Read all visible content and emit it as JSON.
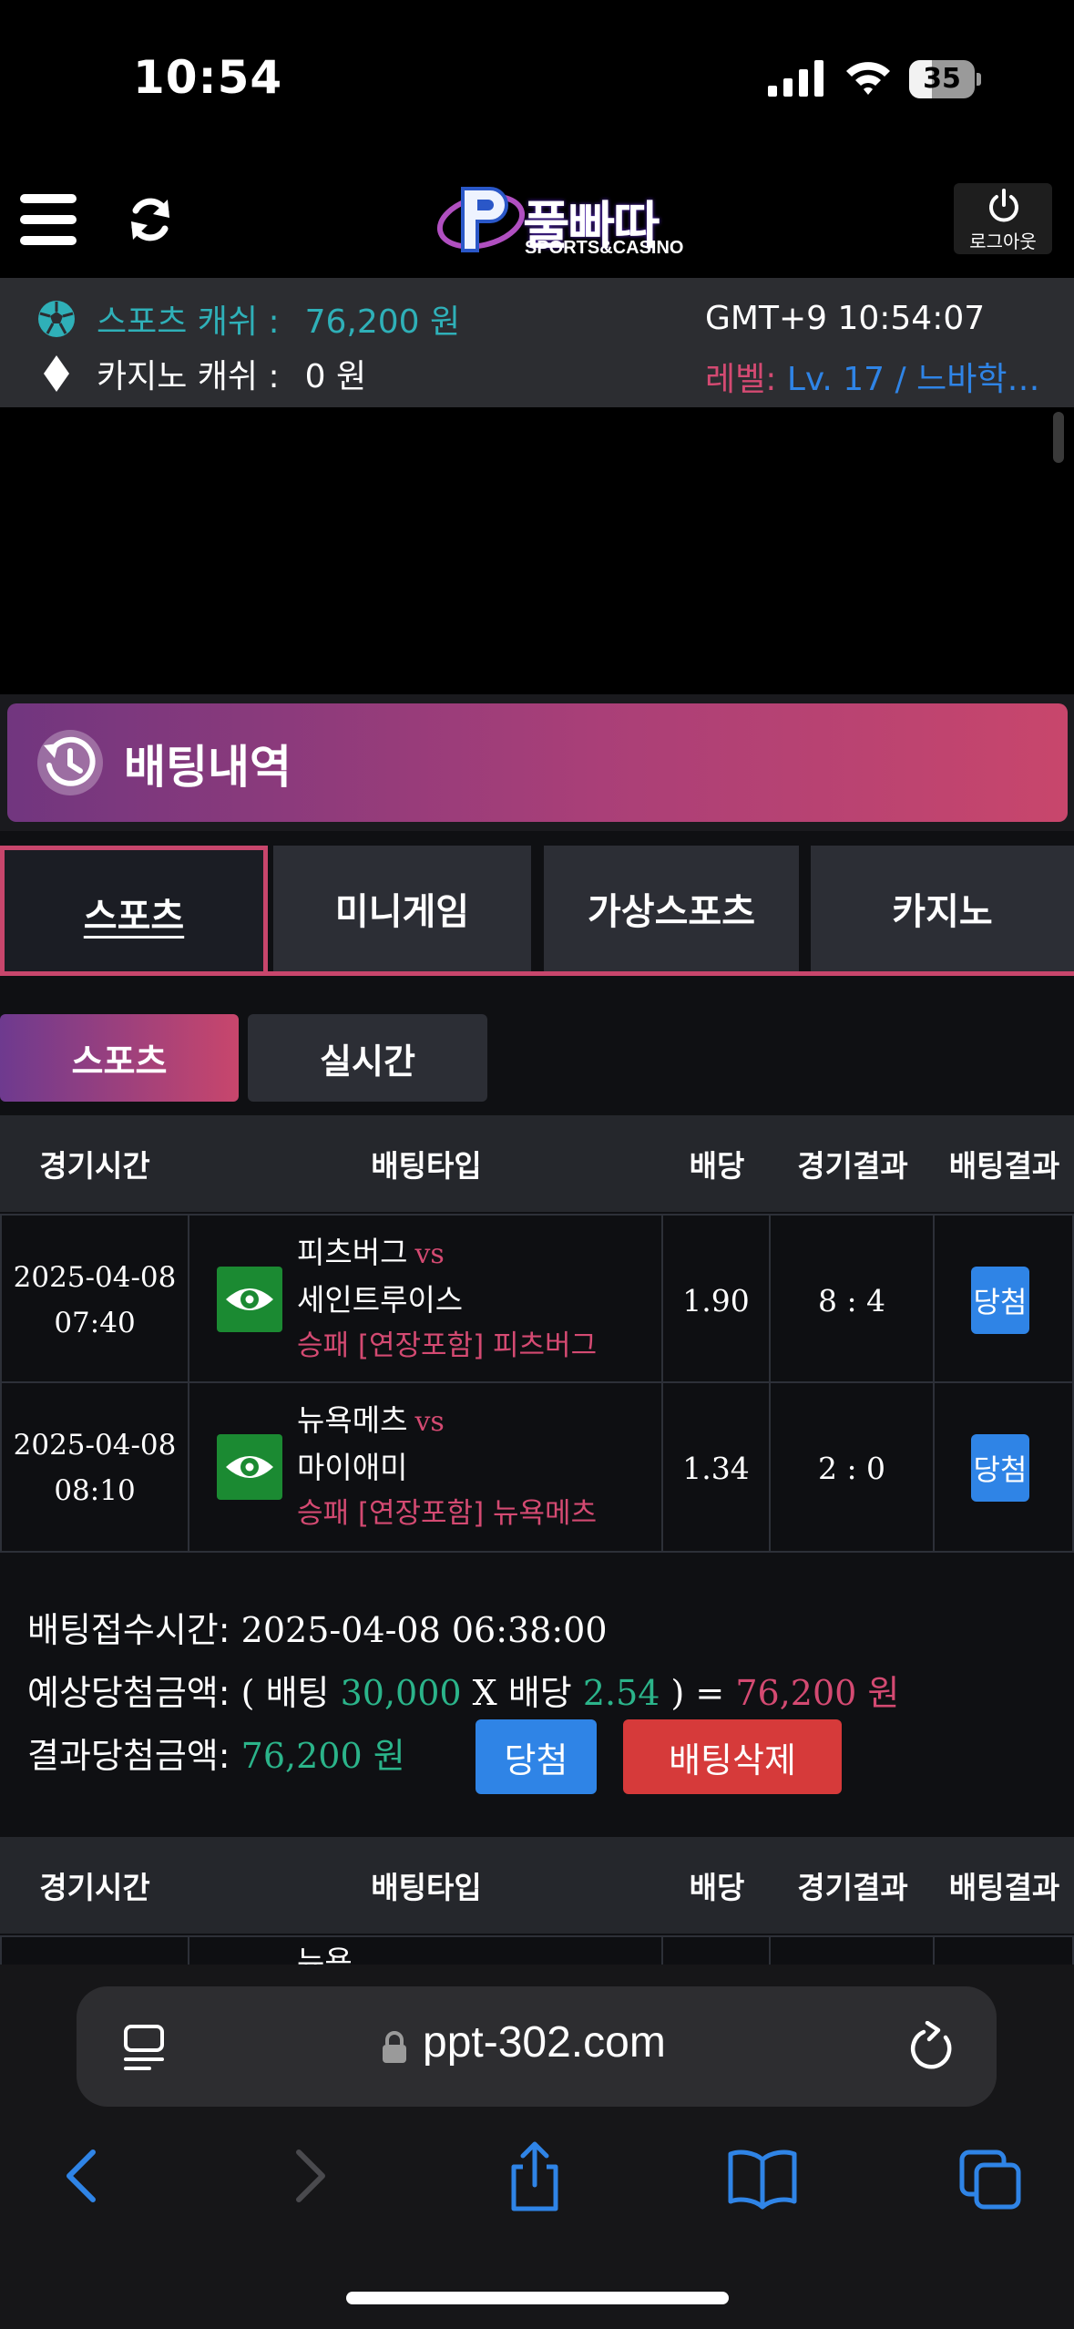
{
  "status_bar": {
    "time": "10:54",
    "battery": "35",
    "battery_level": 0.35
  },
  "header": {
    "logo_text": "풀빠따",
    "logo_sub": "SPORTS&CASINO",
    "logout_label": "로그아웃"
  },
  "account": {
    "sports_cash_label": "스포츠 캐쉬 :",
    "sports_cash_value": "76,200 원",
    "casino_cash_label": "카지노 캐쉬 :",
    "casino_cash_value": "0 원",
    "clock": "GMT+9 10:54:07",
    "level_prefix": "레벨:",
    "level_value": "Lv. 17 / 느바학…"
  },
  "page_title": "배팅내역",
  "main_tabs": [
    {
      "label": "스포츠",
      "active": true
    },
    {
      "label": "미니게임",
      "active": false
    },
    {
      "label": "가상스포츠",
      "active": false
    },
    {
      "label": "카지노",
      "active": false
    }
  ],
  "sub_tabs": [
    {
      "label": "스포츠",
      "active": true
    },
    {
      "label": "실시간",
      "active": false
    }
  ],
  "table_headers": [
    "경기시간",
    "배팅타입",
    "배당",
    "경기결과",
    "배팅결과"
  ],
  "bets": [
    {
      "date": "2025-04-08",
      "time": "07:40",
      "home": "피츠버그",
      "vs": "vs",
      "away": "세인트루이스",
      "pick": "승패 [연장포함] 피츠버그",
      "odds": "1.90",
      "score": "8 : 4",
      "result": "당첨"
    },
    {
      "date": "2025-04-08",
      "time": "08:10",
      "home": "뉴욕메츠",
      "vs": "vs",
      "away": "마이애미",
      "pick": "승패 [연장포함] 뉴욕메츠",
      "odds": "1.34",
      "score": "2 : 0",
      "result": "당첨"
    }
  ],
  "summary": {
    "accept_label": "배팅접수시간:",
    "accept_time": "2025-04-08 06:38:00",
    "expected_label": "예상당첨금액:",
    "open_paren": "( 배팅",
    "stake": "30,000",
    "x": "X",
    "odds_label": "배당",
    "total_odds": "2.54",
    "close_eq": ") =",
    "expected_amount": "76,200 원",
    "result_label": "결과당첨금액:",
    "result_amount": "76,200 원",
    "win_button": "당첨",
    "delete_button": "배팅삭제"
  },
  "next_row_partial": "뉴욕...",
  "browser": {
    "url": "ppt-302.com"
  },
  "colors": {
    "accent_pink": "#c8466c",
    "win_blue": "#2f84e6",
    "delete_red": "#d63a3a",
    "amount_green": "#2bb48a",
    "cash_teal": "#2fb0b8"
  }
}
